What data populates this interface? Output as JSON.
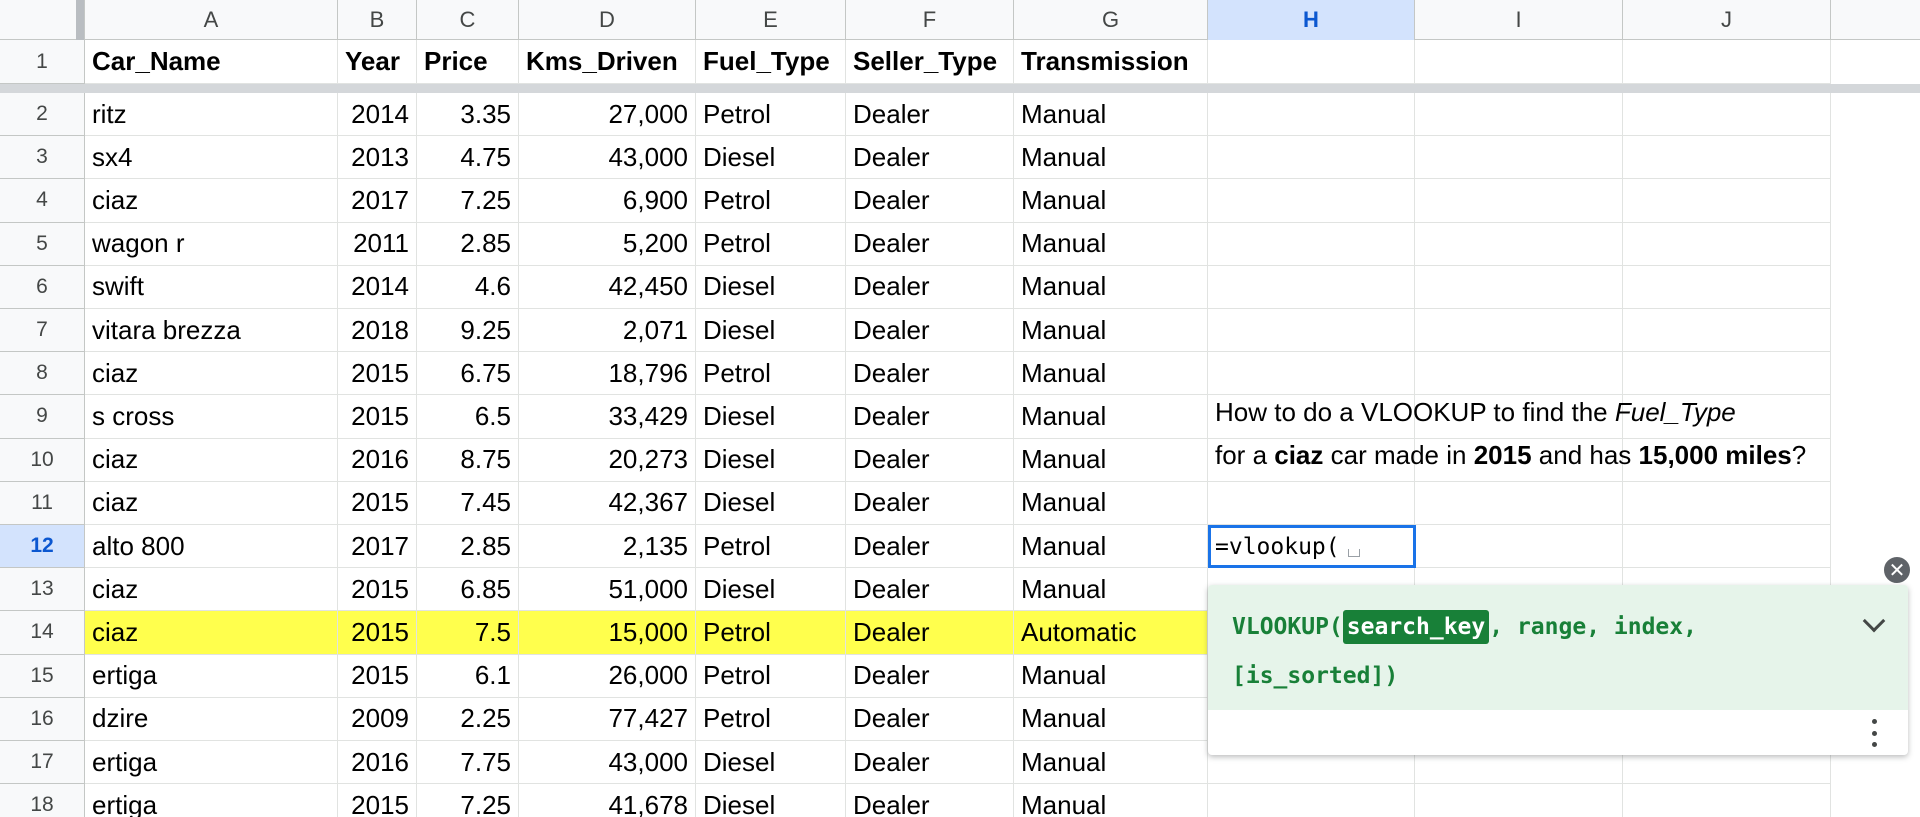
{
  "columns": [
    "A",
    "B",
    "C",
    "D",
    "E",
    "F",
    "G",
    "H",
    "I",
    "J"
  ],
  "active_column": "H",
  "active_row": "12",
  "headers": [
    "Car_Name",
    "Year",
    "Price",
    "Kms_Driven",
    "Fuel_Type",
    "Seller_Type",
    "Transmission"
  ],
  "rows": [
    {
      "num": "2",
      "cells": [
        "ritz",
        "2014",
        "3.35",
        "27,000",
        "Petrol",
        "Dealer",
        "Manual"
      ]
    },
    {
      "num": "3",
      "cells": [
        "sx4",
        "2013",
        "4.75",
        "43,000",
        "Diesel",
        "Dealer",
        "Manual"
      ]
    },
    {
      "num": "4",
      "cells": [
        "ciaz",
        "2017",
        "7.25",
        "6,900",
        "Petrol",
        "Dealer",
        "Manual"
      ]
    },
    {
      "num": "5",
      "cells": [
        "wagon r",
        "2011",
        "2.85",
        "5,200",
        "Petrol",
        "Dealer",
        "Manual"
      ]
    },
    {
      "num": "6",
      "cells": [
        "swift",
        "2014",
        "4.6",
        "42,450",
        "Diesel",
        "Dealer",
        "Manual"
      ]
    },
    {
      "num": "7",
      "cells": [
        "vitara brezza",
        "2018",
        "9.25",
        "2,071",
        "Diesel",
        "Dealer",
        "Manual"
      ]
    },
    {
      "num": "8",
      "cells": [
        "ciaz",
        "2015",
        "6.75",
        "18,796",
        "Petrol",
        "Dealer",
        "Manual"
      ]
    },
    {
      "num": "9",
      "cells": [
        "s cross",
        "2015",
        "6.5",
        "33,429",
        "Diesel",
        "Dealer",
        "Manual"
      ]
    },
    {
      "num": "10",
      "cells": [
        "ciaz",
        "2016",
        "8.75",
        "20,273",
        "Diesel",
        "Dealer",
        "Manual"
      ]
    },
    {
      "num": "11",
      "cells": [
        "ciaz",
        "2015",
        "7.45",
        "42,367",
        "Diesel",
        "Dealer",
        "Manual"
      ]
    },
    {
      "num": "12",
      "cells": [
        "alto 800",
        "2017",
        "2.85",
        "2,135",
        "Petrol",
        "Dealer",
        "Manual"
      ]
    },
    {
      "num": "13",
      "cells": [
        "ciaz",
        "2015",
        "6.85",
        "51,000",
        "Diesel",
        "Dealer",
        "Manual"
      ]
    },
    {
      "num": "14",
      "cells": [
        "ciaz",
        "2015",
        "7.5",
        "15,000",
        "Petrol",
        "Dealer",
        "Automatic"
      ],
      "highlight": true
    },
    {
      "num": "15",
      "cells": [
        "ertiga",
        "2015",
        "6.1",
        "26,000",
        "Petrol",
        "Dealer",
        "Manual"
      ]
    },
    {
      "num": "16",
      "cells": [
        "dzire",
        "2009",
        "2.25",
        "77,427",
        "Petrol",
        "Dealer",
        "Manual"
      ]
    },
    {
      "num": "17",
      "cells": [
        "ertiga",
        "2016",
        "7.75",
        "43,000",
        "Diesel",
        "Dealer",
        "Manual"
      ]
    },
    {
      "num": "18",
      "cells": [
        "ertiga",
        "2015",
        "7.25",
        "41,678",
        "Diesel",
        "Dealer",
        "Manual"
      ]
    }
  ],
  "highlight_color": "#ffff4d",
  "note": {
    "line1_prefix": "How to do a VLOOKUP to find the ",
    "line1_italic": "Fuel_Type",
    "line2_a": "for a ",
    "line2_b": "ciaz",
    "line2_c": " car made in ",
    "line2_d": "2015",
    "line2_e": " and has ",
    "line2_f": "15,000 miles",
    "line2_g": "?"
  },
  "editor": {
    "value": "=vlookup("
  },
  "formula_help": {
    "fn": "VLOOKUP(",
    "active_arg": "search_key",
    "rest_line1": ", range, index,",
    "line2": "[is_sorted])",
    "close_icon": "close-icon",
    "expand_icon": "chevron-down-icon",
    "more_icon": "more-vert-icon"
  }
}
